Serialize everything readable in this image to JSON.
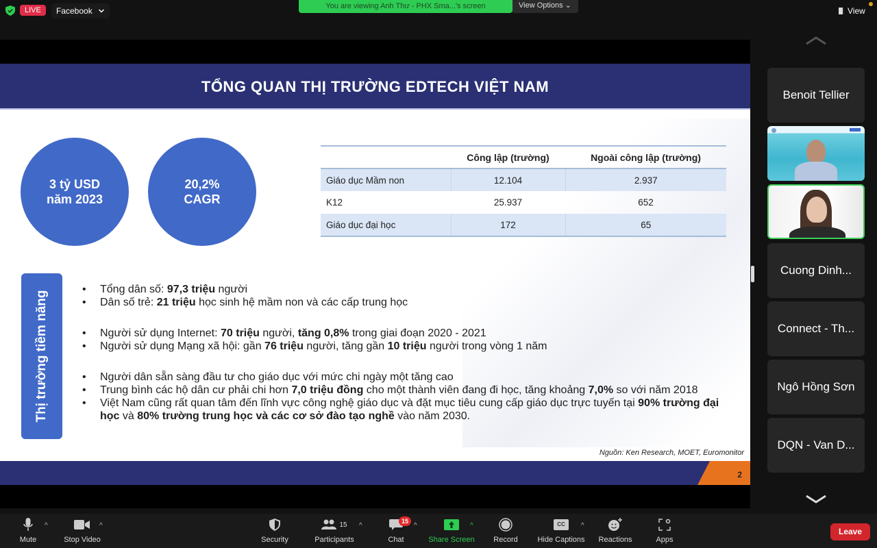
{
  "topbar": {
    "live_label": "LIVE",
    "stream_target": "Facebook",
    "viewing_banner": "You are viewing Anh Thư - PHX Sma...'s screen",
    "view_options": "View Options",
    "view_label": "View"
  },
  "slide": {
    "title": "TỔNG QUAN THỊ TRƯỜNG EDTECH VIỆT NAM",
    "stat1_line1": "3 tỷ USD",
    "stat1_line2": "năm 2023",
    "stat2_line1": "20,2%",
    "stat2_line2": "CAGR",
    "table": {
      "headers": [
        "",
        "Công lập (trường)",
        "Ngoài công lập (trường)"
      ],
      "rows": [
        [
          "Giáo dục Mầm non",
          "12.104",
          "2.937"
        ],
        [
          "K12",
          "25.937",
          "652"
        ],
        [
          "Giáo dục đại học",
          "172",
          "65"
        ]
      ]
    },
    "side_label": "Thị trường tiềm năng",
    "bullets": [
      {
        "pre": "Tổng dân số: ",
        "b1": "97,3 triệu",
        "mid": " người",
        "b2": "",
        "post": ""
      },
      {
        "pre": "Dân số trẻ: ",
        "b1": "21 triệu",
        "mid": " học sinh hệ mầm non và các cấp trung học",
        "b2": "",
        "post": ""
      },
      {
        "pre": "Người sử dụng Internet: ",
        "b1": "70 triệu",
        "mid": " người, ",
        "b2": "tăng 0,8%",
        "post": " trong giai đoạn 2020 - 2021"
      },
      {
        "pre": "Người sử dụng Mạng xã hội: gần ",
        "b1": "76 triệu",
        "mid": " người, tăng gần ",
        "b2": "10 triệu",
        "post": " người trong vòng 1 năm"
      },
      {
        "pre": "Người dân sẵn sàng đầu tư cho giáo dục với mức chi ngày một tăng cao",
        "b1": "",
        "mid": "",
        "b2": "",
        "post": ""
      },
      {
        "pre": "Trung bình các hộ dân cư phải chi hơn ",
        "b1": "7,0 triệu đồng",
        "mid": " cho một thành viên đang đi học, tăng khoảng ",
        "b2": "7,0%",
        "post": " so với năm 2018"
      },
      {
        "pre": "Việt Nam cũng rất quan tâm đến lĩnh vực công nghệ giáo dục và đặt mục tiêu cung cấp giáo dục trực tuyến tại ",
        "b1": "90% trường đại học",
        "mid": " và ",
        "b2": "80% trường trung học và các cơ sở đào tạo nghề",
        "post": " vào năm 2030."
      }
    ],
    "source": "Nguồn: Ken Research, MOET, Euromonitor",
    "page_number": "2"
  },
  "participants": [
    {
      "name": "Benoit Tellier",
      "video": false
    },
    {
      "name": "",
      "video": true
    },
    {
      "name": "",
      "video": true,
      "active": true
    },
    {
      "name": "Cuong Dinh...",
      "video": false
    },
    {
      "name": "Connect - Th...",
      "video": false
    },
    {
      "name": "Ngô Hồng Sơn",
      "video": false
    },
    {
      "name": "DQN - Van D...",
      "video": false
    }
  ],
  "toolbar": {
    "mute": "Mute",
    "stop_video": "Stop Video",
    "security": "Security",
    "participants": "Participants",
    "participants_count": "15",
    "chat": "Chat",
    "chat_badge": "15",
    "share_screen": "Share Screen",
    "record": "Record",
    "hide_captions": "Hide Captions",
    "cc": "CC",
    "reactions": "Reactions",
    "apps": "Apps",
    "leave": "Leave"
  },
  "colors": {
    "slide_navy": "#2a3073",
    "slide_blue": "#4169c8",
    "slide_orange": "#e8731f",
    "zoom_green": "#2ecc52",
    "live_red": "#e02d49",
    "leave_red": "#d2262c"
  }
}
